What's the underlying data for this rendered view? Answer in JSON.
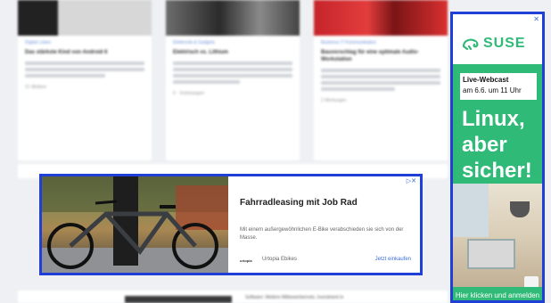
{
  "background": {
    "cards": [
      {
        "category": "Digital Leben",
        "title": "Das stärkste Kind von Android 6",
        "meta": "21 Weitere"
      },
      {
        "category": "Elektronik & Gadgets",
        "title": "Elektrisch vs. Lithium",
        "meta": "6 · Vorlesungen"
      },
      {
        "category": "Business IT Kommunikation",
        "title": "Bauvorschlag für eine optimale Audio-Workstation",
        "meta": "2 Wertungen"
      }
    ],
    "bottom_title": "Software: Weitere Mitbewerbernetz, investment in"
  },
  "ad_middle": {
    "ad_icons": "▷✕",
    "headline": "Fahrradleasing mit Job Rad",
    "body": "Mit einem außergewöhnlichen E-Bike verabschieden sie sich von der Masse.",
    "advertiser_logo": "urtopia",
    "advertiser_name": "Urtopia Ebikes",
    "cta": "Jetzt einkaufen"
  },
  "ad_side": {
    "close": "✕",
    "brand": "SUSE",
    "webcast_title": "Live-Webcast",
    "webcast_date": "am 6.6. um 11 Uhr",
    "slogan_lines": [
      "Linux,",
      "aber",
      "sicher!"
    ],
    "cta": "Hier klicken und anmelden"
  },
  "colors": {
    "ad_border": "#1f3fd6",
    "suse_green": "#30ba78",
    "link_blue": "#3b6fd8"
  }
}
